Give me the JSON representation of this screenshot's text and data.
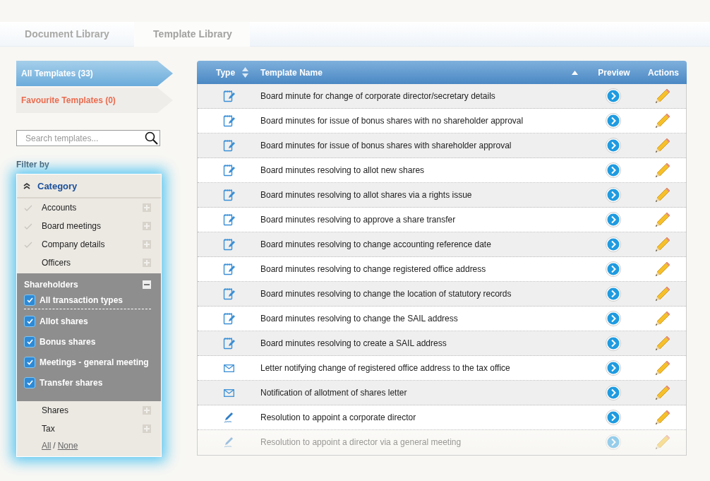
{
  "tabs": [
    {
      "label": "Document Library",
      "selected": false
    },
    {
      "label": "Template Library",
      "selected": true
    }
  ],
  "views": [
    {
      "label": "All Templates (33)",
      "selected": true
    },
    {
      "label": "Favourite Templates (0)",
      "selected": false
    }
  ],
  "search": {
    "placeholder": "Search templates..."
  },
  "filter": {
    "label": "Filter by",
    "title": "Category",
    "expanded": true,
    "items": [
      {
        "label": "Accounts",
        "checked": true,
        "expanded": false
      },
      {
        "label": "Board meetings",
        "checked": true,
        "expanded": false
      },
      {
        "label": "Company details",
        "checked": true,
        "expanded": false
      },
      {
        "label": "Officers",
        "checked": false,
        "expanded": false
      },
      {
        "label": "Shareholders",
        "expanded": true,
        "children": [
          {
            "label": "All transaction types",
            "checked": true
          },
          {
            "label": "Allot shares",
            "checked": true
          },
          {
            "label": "Bonus shares",
            "checked": true
          },
          {
            "label": "Meetings - general meeting",
            "checked": true
          },
          {
            "label": "Transfer shares",
            "checked": true
          }
        ]
      },
      {
        "label": "Shares",
        "checked": false,
        "expanded": false
      },
      {
        "label": "Tax",
        "checked": false,
        "expanded": false
      }
    ],
    "all_link": "All",
    "separator": "/",
    "none_link": "None"
  },
  "table": {
    "columns": [
      "Type",
      "Template Name",
      "Preview",
      "Actions"
    ],
    "rows": [
      {
        "kind": "minute",
        "name": "Board minute for change of corporate director/secretary details",
        "faded": false
      },
      {
        "kind": "minute",
        "name": "Board minutes for issue of bonus shares with no shareholder approval",
        "faded": false
      },
      {
        "kind": "minute",
        "name": "Board minutes for issue of bonus shares with shareholder approval",
        "faded": false
      },
      {
        "kind": "minute",
        "name": "Board minutes resolving to allot new shares",
        "faded": false
      },
      {
        "kind": "minute",
        "name": "Board minutes resolving to allot shares via a rights issue",
        "faded": false
      },
      {
        "kind": "minute",
        "name": "Board minutes resolving to approve a share transfer",
        "faded": false
      },
      {
        "kind": "minute",
        "name": "Board minutes resolving to change accounting reference date",
        "faded": false
      },
      {
        "kind": "minute",
        "name": "Board minutes resolving to change registered office address",
        "faded": false
      },
      {
        "kind": "minute",
        "name": "Board minutes resolving to change the location of statutory records",
        "faded": false
      },
      {
        "kind": "minute",
        "name": "Board minutes resolving to change the SAIL address",
        "faded": false
      },
      {
        "kind": "minute",
        "name": "Board minutes resolving to create a SAIL address",
        "faded": false
      },
      {
        "kind": "letter",
        "name": "Letter notifying change of registered office address to the tax office",
        "faded": false
      },
      {
        "kind": "letter",
        "name": "Notification of allotment of shares letter",
        "faded": false
      },
      {
        "kind": "resolution",
        "name": "Resolution to appoint a corporate director",
        "faded": false
      },
      {
        "kind": "resolution",
        "name": "Resolution to appoint a director via a general meeting",
        "faded": true
      }
    ]
  }
}
